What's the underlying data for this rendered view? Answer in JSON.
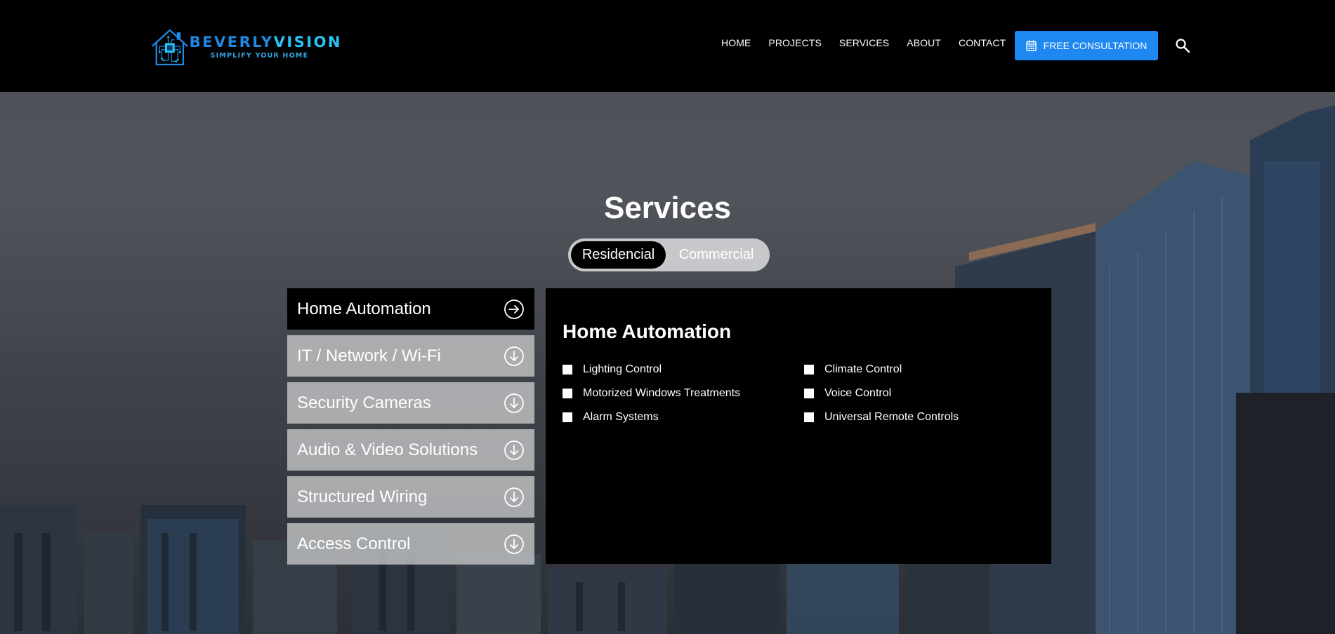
{
  "header": {
    "logo": {
      "brand_part1": "BEVERLY",
      "brand_part2": "VISION",
      "tagline": "SIMPLIFY YOUR HOME"
    },
    "nav": [
      "HOME",
      "PROJECTS",
      "SERVICES",
      "ABOUT",
      "CONTACT"
    ],
    "cta_label": "FREE CONSULTATION"
  },
  "services": {
    "title": "Services",
    "toggle": {
      "active": "Residencial",
      "inactive": "Commercial"
    },
    "tabs": [
      {
        "label": "Home Automation",
        "active": true
      },
      {
        "label": "IT / Network / Wi-Fi",
        "active": false
      },
      {
        "label": "Security Cameras",
        "active": false
      },
      {
        "label": "Audio & Video Solutions",
        "active": false
      },
      {
        "label": "Structured Wiring",
        "active": false
      },
      {
        "label": "Access Control",
        "active": false
      }
    ],
    "panel": {
      "title": "Home Automation",
      "features": [
        "Lighting Control",
        "Climate Control",
        "Motorized Windows Treatments",
        "Voice Control",
        "Alarm Systems",
        "Universal Remote Controls"
      ]
    }
  },
  "colors": {
    "header_bg": "#000000",
    "accent": "#1e88f0",
    "logo_blue": "#1e88e5",
    "logo_cyan": "#29c4f6"
  }
}
